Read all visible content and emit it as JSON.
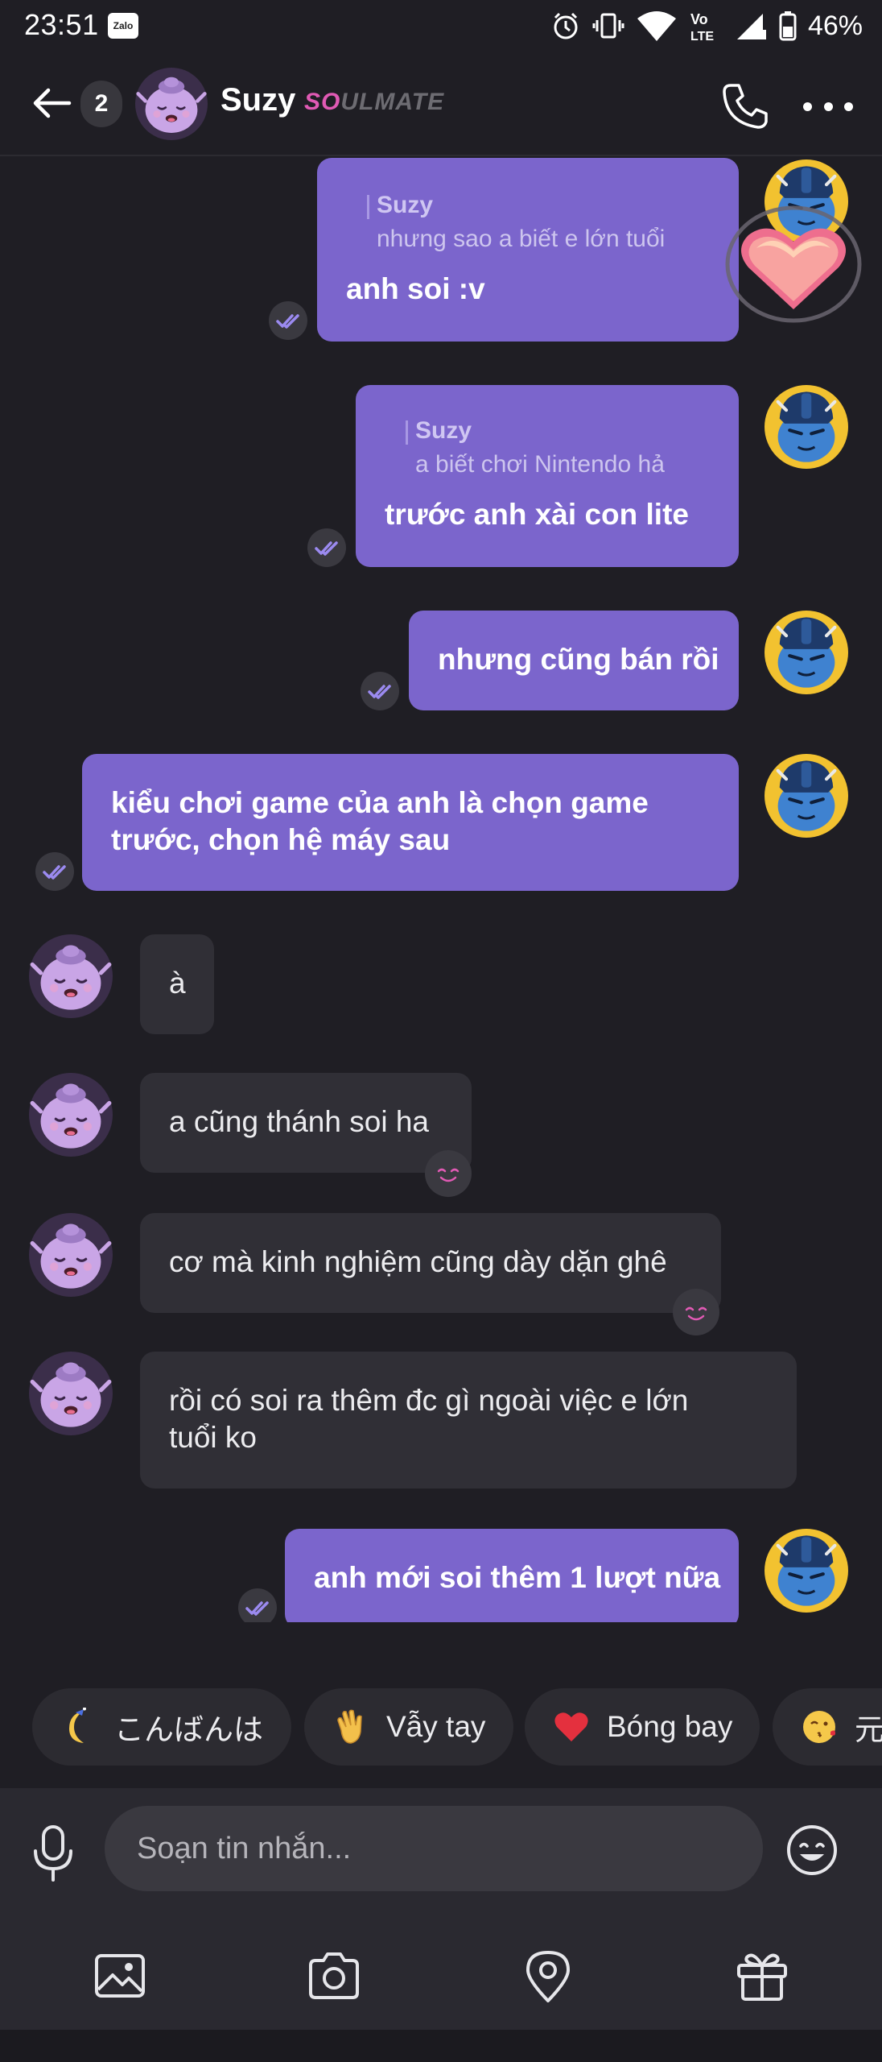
{
  "status_bar": {
    "time": "23:51",
    "app_badge": "Zalo",
    "battery": "46%"
  },
  "header": {
    "unread_count": "2",
    "contact_name": "Suzy",
    "tag_pink": "SO",
    "tag_rest": "ULMATE"
  },
  "messages": [
    {
      "direction": "out",
      "reply_name": "Suzy",
      "reply_text": "nhưng sao a biết e lớn tuổi",
      "text": "anh soi :v"
    },
    {
      "direction": "out",
      "reply_name": "Suzy",
      "reply_text": "a biết chơi Nintendo hả",
      "text": "trước anh xài con lite"
    },
    {
      "direction": "out",
      "text": "nhưng cũng bán rồi"
    },
    {
      "direction": "out",
      "lines": [
        "kiểu chơi game của anh là chọn game",
        "trước, chọn hệ máy sau"
      ]
    },
    {
      "direction": "in",
      "text": "à"
    },
    {
      "direction": "in",
      "text": "a cũng thánh soi ha"
    },
    {
      "direction": "in",
      "text": "cơ mà kinh nghiệm cũng dày dặn ghê"
    },
    {
      "direction": "in",
      "lines": [
        "rồi có soi ra thêm đc gì ngoài việc e lớn",
        "tuổi ko"
      ]
    },
    {
      "direction": "out",
      "text": "anh mới soi thêm 1 lượt nữa"
    }
  ],
  "quick_replies": [
    {
      "icon": "moon-icon",
      "label": "こんばんは"
    },
    {
      "icon": "waving-hand-icon",
      "label": "Vẫy tay"
    },
    {
      "icon": "heart-icon",
      "label": "Bóng bay"
    },
    {
      "icon": "kiss-face-icon",
      "label": "元"
    }
  ],
  "composer": {
    "placeholder": "Soạn tin nhắn..."
  },
  "colors": {
    "outgoing_bubble": "#7b65cc",
    "incoming_bubble": "#302f36",
    "background": "#1f1e24",
    "accent_pink": "#e05ab4"
  }
}
